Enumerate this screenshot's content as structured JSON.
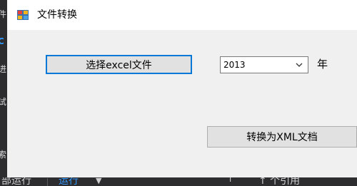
{
  "window": {
    "title": "文件转换"
  },
  "buttons": {
    "select_excel": "选择excel文件",
    "convert_xml": "转换为XML文档"
  },
  "year_select": {
    "value": "2013",
    "unit_label": "年"
  },
  "background": {
    "left_strip_glyphs": [
      "件",
      "C",
      "进",
      "试",
      "·",
      "索"
    ],
    "status_items": [
      "部运行",
      "运行",
      "▼",
      "「",
      "↑ 个引用"
    ]
  },
  "icons": {
    "app_icon": "app-grid-icon",
    "dropdown": "chevron-down-icon"
  },
  "colors": {
    "focus_border": "#0078d7",
    "ide_background": "#2d2d30",
    "status_link": "#3399ff"
  }
}
